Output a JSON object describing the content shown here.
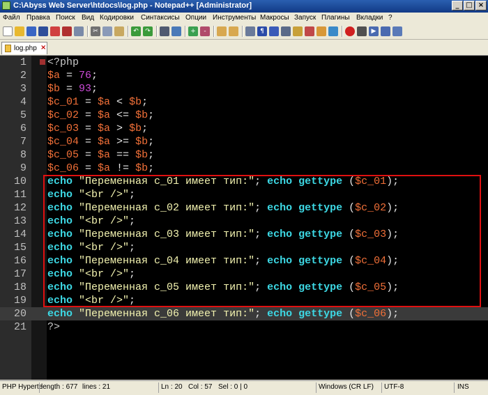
{
  "window": {
    "title": "C:\\Abyss Web Server\\htdocs\\log.php - Notepad++ [Administrator]"
  },
  "menu": [
    "Файл",
    "Правка",
    "Поиск",
    "Вид",
    "Кодировки",
    "Синтаксисы",
    "Опции",
    "Инструменты",
    "Макросы",
    "Запуск",
    "Плагины",
    "Вкладки",
    "?"
  ],
  "tab": {
    "label": "log.php",
    "close": "×"
  },
  "code_lines": [
    {
      "n": "1",
      "t": [
        [
          "tag",
          "<?php"
        ]
      ]
    },
    {
      "n": "2",
      "t": [
        [
          "var",
          "$a"
        ],
        [
          "op",
          " = "
        ],
        [
          "num",
          "76"
        ],
        [
          "op",
          ";"
        ]
      ]
    },
    {
      "n": "3",
      "t": [
        [
          "var",
          "$b"
        ],
        [
          "op",
          " = "
        ],
        [
          "num",
          "93"
        ],
        [
          "op",
          ";"
        ]
      ]
    },
    {
      "n": "4",
      "t": [
        [
          "var",
          "$c_01"
        ],
        [
          "op",
          " = "
        ],
        [
          "var",
          "$a"
        ],
        [
          "op",
          " < "
        ],
        [
          "var",
          "$b"
        ],
        [
          "op",
          ";"
        ]
      ]
    },
    {
      "n": "5",
      "t": [
        [
          "var",
          "$c_02"
        ],
        [
          "op",
          " = "
        ],
        [
          "var",
          "$a"
        ],
        [
          "op",
          " <= "
        ],
        [
          "var",
          "$b"
        ],
        [
          "op",
          ";"
        ]
      ]
    },
    {
      "n": "6",
      "t": [
        [
          "var",
          "$c_03"
        ],
        [
          "op",
          " = "
        ],
        [
          "var",
          "$a"
        ],
        [
          "op",
          " > "
        ],
        [
          "var",
          "$b"
        ],
        [
          "op",
          ";"
        ]
      ]
    },
    {
      "n": "7",
      "t": [
        [
          "var",
          "$c_04"
        ],
        [
          "op",
          " = "
        ],
        [
          "var",
          "$a"
        ],
        [
          "op",
          " >= "
        ],
        [
          "var",
          "$b"
        ],
        [
          "op",
          ";"
        ]
      ]
    },
    {
      "n": "8",
      "t": [
        [
          "var",
          "$c_05"
        ],
        [
          "op",
          " = "
        ],
        [
          "var",
          "$a"
        ],
        [
          "op",
          " == "
        ],
        [
          "var",
          "$b"
        ],
        [
          "op",
          ";"
        ]
      ]
    },
    {
      "n": "9",
      "t": [
        [
          "var",
          "$c_06"
        ],
        [
          "op",
          " = "
        ],
        [
          "var",
          "$a"
        ],
        [
          "op",
          " != "
        ],
        [
          "var",
          "$b"
        ],
        [
          "op",
          ";"
        ]
      ]
    },
    {
      "n": "10",
      "t": [
        [
          "kw",
          "echo"
        ],
        [
          "op",
          " "
        ],
        [
          "str",
          "\"Переменная c_01 имеет тип:\""
        ],
        [
          "op",
          "; "
        ],
        [
          "kw",
          "echo"
        ],
        [
          "op",
          " "
        ],
        [
          "kw",
          "gettype"
        ],
        [
          "op",
          " ("
        ],
        [
          "var",
          "$c_01"
        ],
        [
          "op",
          ");"
        ]
      ]
    },
    {
      "n": "11",
      "t": [
        [
          "kw",
          "echo"
        ],
        [
          "op",
          " "
        ],
        [
          "str",
          "\"<br />\""
        ],
        [
          "op",
          ";"
        ]
      ]
    },
    {
      "n": "12",
      "t": [
        [
          "kw",
          "echo"
        ],
        [
          "op",
          " "
        ],
        [
          "str",
          "\"Переменная c_02 имеет тип:\""
        ],
        [
          "op",
          "; "
        ],
        [
          "kw",
          "echo"
        ],
        [
          "op",
          " "
        ],
        [
          "kw",
          "gettype"
        ],
        [
          "op",
          " ("
        ],
        [
          "var",
          "$c_02"
        ],
        [
          "op",
          ");"
        ]
      ]
    },
    {
      "n": "13",
      "t": [
        [
          "kw",
          "echo"
        ],
        [
          "op",
          " "
        ],
        [
          "str",
          "\"<br />\""
        ],
        [
          "op",
          ";"
        ]
      ]
    },
    {
      "n": "14",
      "t": [
        [
          "kw",
          "echo"
        ],
        [
          "op",
          " "
        ],
        [
          "str",
          "\"Переменная c_03 имеет тип:\""
        ],
        [
          "op",
          "; "
        ],
        [
          "kw",
          "echo"
        ],
        [
          "op",
          " "
        ],
        [
          "kw",
          "gettype"
        ],
        [
          "op",
          " ("
        ],
        [
          "var",
          "$c_03"
        ],
        [
          "op",
          ");"
        ]
      ]
    },
    {
      "n": "15",
      "t": [
        [
          "kw",
          "echo"
        ],
        [
          "op",
          " "
        ],
        [
          "str",
          "\"<br />\""
        ],
        [
          "op",
          ";"
        ]
      ]
    },
    {
      "n": "16",
      "t": [
        [
          "kw",
          "echo"
        ],
        [
          "op",
          " "
        ],
        [
          "str",
          "\"Переменная c_04 имеет тип:\""
        ],
        [
          "op",
          "; "
        ],
        [
          "kw",
          "echo"
        ],
        [
          "op",
          " "
        ],
        [
          "kw",
          "gettype"
        ],
        [
          "op",
          " ("
        ],
        [
          "var",
          "$c_04"
        ],
        [
          "op",
          ");"
        ]
      ]
    },
    {
      "n": "17",
      "t": [
        [
          "kw",
          "echo"
        ],
        [
          "op",
          " "
        ],
        [
          "str",
          "\"<br />\""
        ],
        [
          "op",
          ";"
        ]
      ]
    },
    {
      "n": "18",
      "t": [
        [
          "kw",
          "echo"
        ],
        [
          "op",
          " "
        ],
        [
          "str",
          "\"Переменная c_05 имеет тип:\""
        ],
        [
          "op",
          "; "
        ],
        [
          "kw",
          "echo"
        ],
        [
          "op",
          " "
        ],
        [
          "kw",
          "gettype"
        ],
        [
          "op",
          " ("
        ],
        [
          "var",
          "$c_05"
        ],
        [
          "op",
          ");"
        ]
      ]
    },
    {
      "n": "19",
      "t": [
        [
          "kw",
          "echo"
        ],
        [
          "op",
          " "
        ],
        [
          "str",
          "\"<br />\""
        ],
        [
          "op",
          ";"
        ]
      ]
    },
    {
      "n": "20",
      "t": [
        [
          "kw",
          "echo"
        ],
        [
          "op",
          " "
        ],
        [
          "str",
          "\"Переменная c_06 имеет тип:\""
        ],
        [
          "op",
          "; "
        ],
        [
          "kw",
          "echo"
        ],
        [
          "op",
          " "
        ],
        [
          "kw",
          "gettype"
        ],
        [
          "op",
          " ("
        ],
        [
          "var",
          "$c_06"
        ],
        [
          "op",
          ");"
        ]
      ],
      "current": true
    },
    {
      "n": "21",
      "t": [
        [
          "tag",
          "?>"
        ]
      ]
    }
  ],
  "status": {
    "lang": "PHP Hyperte",
    "length": "length : 677",
    "lines": "lines : 21",
    "ln": "Ln : 20",
    "col": "Col : 57",
    "sel": "Sel : 0 | 0",
    "eol": "Windows (CR LF)",
    "enc": "UTF-8",
    "ins": "INS"
  },
  "colors": {
    "keyword": "#3dd8e4",
    "string": "#f3f3b0",
    "variable": "#f27038",
    "number": "#cc4bd8",
    "highlight_box": "#e01010"
  },
  "icons": [
    "new-file-icon",
    "open-icon",
    "save-icon",
    "save-all-icon",
    "close-icon",
    "close-all-icon",
    "print-icon",
    "cut-icon",
    "copy-icon",
    "paste-icon",
    "undo-icon",
    "redo-icon",
    "find-icon",
    "replace-icon",
    "zoom-in-icon",
    "zoom-out-icon",
    "sync-v-icon",
    "sync-h-icon",
    "word-wrap-icon",
    "show-all-icon",
    "indent-guide-icon",
    "udl-icon",
    "doc-map-icon",
    "function-list-icon",
    "folder-workspace-icon",
    "monitor-icon",
    "record-icon",
    "stop-icon",
    "play-icon",
    "play-multi-icon",
    "save-macro-icon"
  ]
}
